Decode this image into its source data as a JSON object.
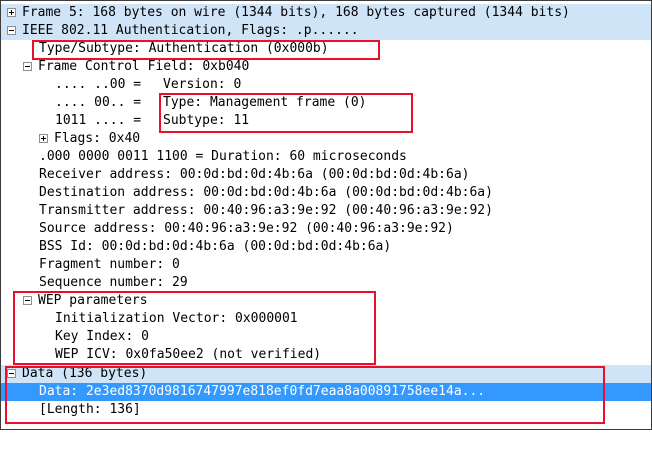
{
  "tree": {
    "frame_summary": "Frame 5: 168 bytes on wire (1344 bits), 168 bytes captured (1344 bits)",
    "ieee_summary": "IEEE 802.11 Authentication, Flags: .p......",
    "type_subtype": "Type/Subtype: Authentication (0x000b)",
    "frame_control": "Frame Control Field: 0xb040",
    "version_bits": ".... ..00 = ",
    "version_label": "Version: 0",
    "type_bits": ".... 00.. = ",
    "type_label": "Type: Management frame (0)",
    "subtype_bits": "1011 .... = ",
    "subtype_label": "Subtype: 11",
    "flags": "Flags: 0x40",
    "duration": ".000 0000 0011 1100 = Duration: 60 microseconds",
    "receiver": "Receiver address: 00:0d:bd:0d:4b:6a (00:0d:bd:0d:4b:6a)",
    "destination": "Destination address: 00:0d:bd:0d:4b:6a (00:0d:bd:0d:4b:6a)",
    "transmitter": "Transmitter address: 00:40:96:a3:9e:92 (00:40:96:a3:9e:92)",
    "source": "Source address: 00:40:96:a3:9e:92 (00:40:96:a3:9e:92)",
    "bss": "BSS Id: 00:0d:bd:0d:4b:6a (00:0d:bd:0d:4b:6a)",
    "fragment": "Fragment number: 0",
    "sequence": "Sequence number: 29",
    "wep": "WEP parameters",
    "iv": "Initialization Vector: 0x000001",
    "key_index": "Key Index: 0",
    "wep_icv": "WEP ICV: 0x0fa50ee2 (not verified)",
    "data_summary": "Data (136 bytes)",
    "data_value": "Data: 2e3ed8370d9816747997e818ef0fd7eaa8a00891758ee14a...",
    "length": "[Length: 136]"
  },
  "colors": {
    "annotation": "#e8112d",
    "selected_row": "#3399ff",
    "summary_row": "#cfe4f7"
  }
}
